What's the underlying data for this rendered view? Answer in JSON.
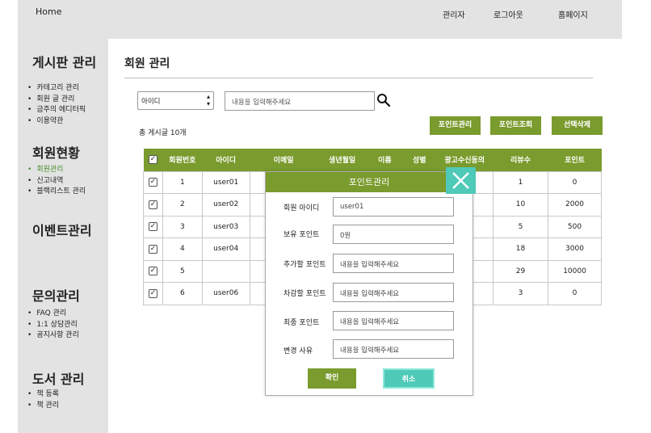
{
  "topbar": {
    "home": "Home",
    "admin": "관리자",
    "logout": "로그아웃",
    "homepage": "홈페이지"
  },
  "sidebar": {
    "board": {
      "title": "게시판 관리",
      "items": [
        "카테고리 관리",
        "회원 글 관리",
        "금주의 에디터픽",
        "이용약관"
      ]
    },
    "members": {
      "title": "회원현황",
      "items": [
        "회원관리",
        "신고내역",
        "블랙리스트 관리"
      ]
    },
    "event": {
      "title": "이벤트관리"
    },
    "inquiry": {
      "title": "문의관리",
      "items": [
        "FAQ 관리",
        "1:1 상담관리",
        "공지사항 관리"
      ]
    },
    "books": {
      "title": "도서 관리",
      "items": [
        "책 등록",
        "책 관리"
      ]
    }
  },
  "main": {
    "title": "회원 관리",
    "search": {
      "select_value": "아이디",
      "placeholder": "내용을 입력해주세요"
    },
    "count_text": "총 게시글 10개",
    "buttons": {
      "point_manage": "포인트관리",
      "point_view": "포인트조회",
      "delete_selected": "선택삭제"
    },
    "table": {
      "headers": [
        "회원번호",
        "아이디",
        "이메일",
        "생년월일",
        "이름",
        "성별",
        "광고수신동의",
        "리뷰수",
        "포인트"
      ],
      "rows": [
        {
          "no": "1",
          "id": "user01",
          "reviews": "1",
          "points": "0"
        },
        {
          "no": "2",
          "id": "user02",
          "reviews": "10",
          "points": "2000"
        },
        {
          "no": "3",
          "id": "user03",
          "reviews": "5",
          "points": "500"
        },
        {
          "no": "4",
          "id": "user04",
          "reviews": "18",
          "points": "3000"
        },
        {
          "no": "5",
          "id": "",
          "reviews": "29",
          "points": "10000"
        },
        {
          "no": "6",
          "id": "user06",
          "reviews": "3",
          "points": "0"
        }
      ]
    }
  },
  "modal": {
    "title": "포인트관리",
    "fields": [
      {
        "label": "회원 아이디",
        "value": "user01"
      },
      {
        "label": "보유 포인트",
        "value": "0원"
      },
      {
        "label": "추가할 포인트",
        "value": "내용을 입력해주세요"
      },
      {
        "label": "차감할 포인트",
        "value": "내용을 입력해주세요"
      },
      {
        "label": "최종 포인트",
        "value": "내용을 입력해주세요"
      },
      {
        "label": "변경 사유",
        "value": "내용을 입력해주세요"
      }
    ],
    "confirm": "확인",
    "cancel": "취소"
  },
  "colors": {
    "accent": "#7a9b2d",
    "cancel": "#4fc9b8",
    "active_nav": "#4a8f2c"
  }
}
